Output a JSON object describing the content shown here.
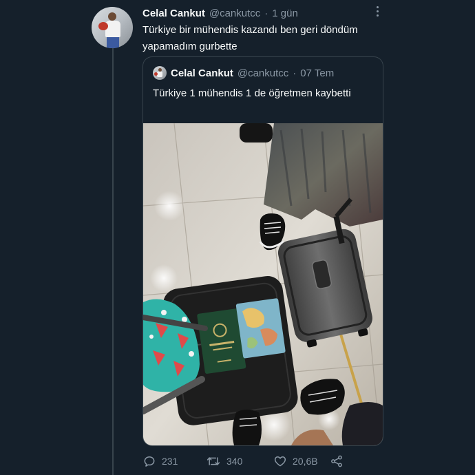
{
  "tweet": {
    "author_name": "Celal Cankut",
    "author_handle": "@cankutcc",
    "separator": "·",
    "time": "1 gün",
    "text": "Türkiye bir mühendis kazandı ben geri döndüm yapamadım gurbette"
  },
  "quoted_tweet": {
    "author_name": "Celal Cankut",
    "author_handle": "@cankutcc",
    "separator": "·",
    "time": "07 Tem",
    "text": "Türkiye 1 mühendis 1 de öğretmen kaybetti"
  },
  "actions": {
    "replies": "231",
    "retweets": "340",
    "likes": "20,6B"
  },
  "icons": {
    "reply": "reply-icon",
    "retweet": "retweet-icon",
    "like": "heart-icon",
    "share": "share-icon",
    "more": "more-icon"
  },
  "colors": {
    "background": "#15202b",
    "border": "#38444d",
    "text_primary": "#f7f9f9",
    "text_secondary": "#8b98a5"
  }
}
